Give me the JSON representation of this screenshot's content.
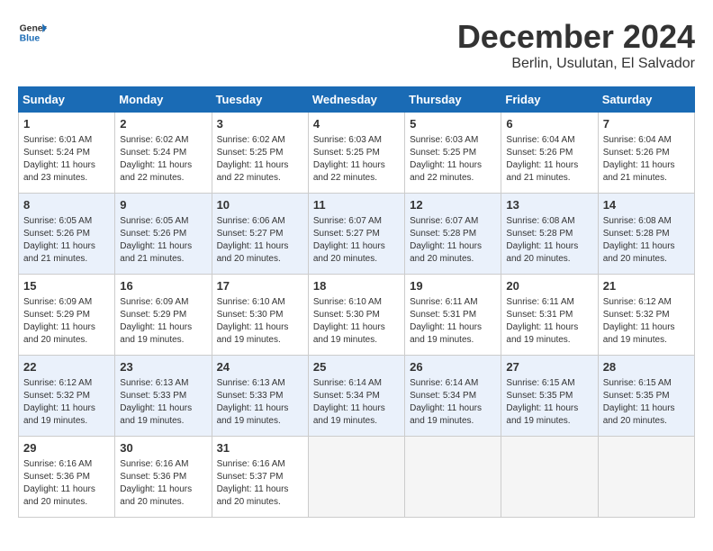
{
  "header": {
    "logo_line1": "General",
    "logo_line2": "Blue",
    "month": "December 2024",
    "location": "Berlin, Usulutan, El Salvador"
  },
  "weekdays": [
    "Sunday",
    "Monday",
    "Tuesday",
    "Wednesday",
    "Thursday",
    "Friday",
    "Saturday"
  ],
  "weeks": [
    [
      {
        "day": "1",
        "info": "Sunrise: 6:01 AM\nSunset: 5:24 PM\nDaylight: 11 hours\nand 23 minutes."
      },
      {
        "day": "2",
        "info": "Sunrise: 6:02 AM\nSunset: 5:24 PM\nDaylight: 11 hours\nand 22 minutes."
      },
      {
        "day": "3",
        "info": "Sunrise: 6:02 AM\nSunset: 5:25 PM\nDaylight: 11 hours\nand 22 minutes."
      },
      {
        "day": "4",
        "info": "Sunrise: 6:03 AM\nSunset: 5:25 PM\nDaylight: 11 hours\nand 22 minutes."
      },
      {
        "day": "5",
        "info": "Sunrise: 6:03 AM\nSunset: 5:25 PM\nDaylight: 11 hours\nand 22 minutes."
      },
      {
        "day": "6",
        "info": "Sunrise: 6:04 AM\nSunset: 5:26 PM\nDaylight: 11 hours\nand 21 minutes."
      },
      {
        "day": "7",
        "info": "Sunrise: 6:04 AM\nSunset: 5:26 PM\nDaylight: 11 hours\nand 21 minutes."
      }
    ],
    [
      {
        "day": "8",
        "info": "Sunrise: 6:05 AM\nSunset: 5:26 PM\nDaylight: 11 hours\nand 21 minutes."
      },
      {
        "day": "9",
        "info": "Sunrise: 6:05 AM\nSunset: 5:26 PM\nDaylight: 11 hours\nand 21 minutes."
      },
      {
        "day": "10",
        "info": "Sunrise: 6:06 AM\nSunset: 5:27 PM\nDaylight: 11 hours\nand 20 minutes."
      },
      {
        "day": "11",
        "info": "Sunrise: 6:07 AM\nSunset: 5:27 PM\nDaylight: 11 hours\nand 20 minutes."
      },
      {
        "day": "12",
        "info": "Sunrise: 6:07 AM\nSunset: 5:28 PM\nDaylight: 11 hours\nand 20 minutes."
      },
      {
        "day": "13",
        "info": "Sunrise: 6:08 AM\nSunset: 5:28 PM\nDaylight: 11 hours\nand 20 minutes."
      },
      {
        "day": "14",
        "info": "Sunrise: 6:08 AM\nSunset: 5:28 PM\nDaylight: 11 hours\nand 20 minutes."
      }
    ],
    [
      {
        "day": "15",
        "info": "Sunrise: 6:09 AM\nSunset: 5:29 PM\nDaylight: 11 hours\nand 20 minutes."
      },
      {
        "day": "16",
        "info": "Sunrise: 6:09 AM\nSunset: 5:29 PM\nDaylight: 11 hours\nand 19 minutes."
      },
      {
        "day": "17",
        "info": "Sunrise: 6:10 AM\nSunset: 5:30 PM\nDaylight: 11 hours\nand 19 minutes."
      },
      {
        "day": "18",
        "info": "Sunrise: 6:10 AM\nSunset: 5:30 PM\nDaylight: 11 hours\nand 19 minutes."
      },
      {
        "day": "19",
        "info": "Sunrise: 6:11 AM\nSunset: 5:31 PM\nDaylight: 11 hours\nand 19 minutes."
      },
      {
        "day": "20",
        "info": "Sunrise: 6:11 AM\nSunset: 5:31 PM\nDaylight: 11 hours\nand 19 minutes."
      },
      {
        "day": "21",
        "info": "Sunrise: 6:12 AM\nSunset: 5:32 PM\nDaylight: 11 hours\nand 19 minutes."
      }
    ],
    [
      {
        "day": "22",
        "info": "Sunrise: 6:12 AM\nSunset: 5:32 PM\nDaylight: 11 hours\nand 19 minutes."
      },
      {
        "day": "23",
        "info": "Sunrise: 6:13 AM\nSunset: 5:33 PM\nDaylight: 11 hours\nand 19 minutes."
      },
      {
        "day": "24",
        "info": "Sunrise: 6:13 AM\nSunset: 5:33 PM\nDaylight: 11 hours\nand 19 minutes."
      },
      {
        "day": "25",
        "info": "Sunrise: 6:14 AM\nSunset: 5:34 PM\nDaylight: 11 hours\nand 19 minutes."
      },
      {
        "day": "26",
        "info": "Sunrise: 6:14 AM\nSunset: 5:34 PM\nDaylight: 11 hours\nand 19 minutes."
      },
      {
        "day": "27",
        "info": "Sunrise: 6:15 AM\nSunset: 5:35 PM\nDaylight: 11 hours\nand 19 minutes."
      },
      {
        "day": "28",
        "info": "Sunrise: 6:15 AM\nSunset: 5:35 PM\nDaylight: 11 hours\nand 20 minutes."
      }
    ],
    [
      {
        "day": "29",
        "info": "Sunrise: 6:16 AM\nSunset: 5:36 PM\nDaylight: 11 hours\nand 20 minutes."
      },
      {
        "day": "30",
        "info": "Sunrise: 6:16 AM\nSunset: 5:36 PM\nDaylight: 11 hours\nand 20 minutes."
      },
      {
        "day": "31",
        "info": "Sunrise: 6:16 AM\nSunset: 5:37 PM\nDaylight: 11 hours\nand 20 minutes."
      },
      null,
      null,
      null,
      null
    ]
  ]
}
